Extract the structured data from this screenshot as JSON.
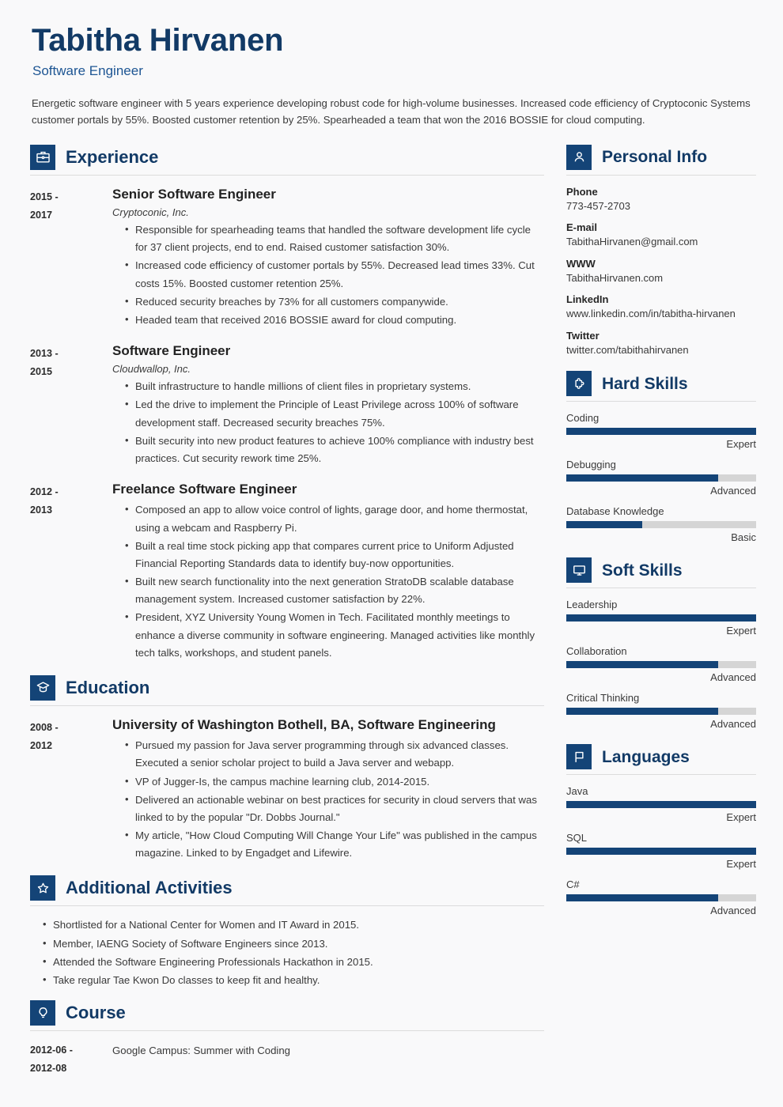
{
  "header": {
    "name": "Tabitha Hirvanen",
    "job_title": "Software Engineer",
    "summary": "Energetic software engineer with 5 years experience developing robust code for high-volume businesses. Increased code efficiency of Cryptoconic Systems customer portals by 55%. Boosted customer retention by 25%. Spearheaded a team that won the 2016 BOSSIE for cloud computing."
  },
  "theme": {
    "navy": "#144477",
    "heading_navy": "#123a66",
    "subtitle_blue": "#1d5593",
    "bar_track": "#d5d5d5",
    "page_bg": "#f9f9fa",
    "rule": "#dcdcdc"
  },
  "sections": {
    "experience": {
      "title": "Experience",
      "icon": "briefcase-icon",
      "entries": [
        {
          "dates_from": "2015 -",
          "dates_to": "2017",
          "title": "Senior Software Engineer",
          "org": "Cryptoconic, Inc.",
          "bullets": [
            "Responsible for spearheading teams that handled the software development life cycle for 37 client projects, end to end. Raised customer satisfaction 30%.",
            "Increased code efficiency of customer portals by 55%. Decreased lead times 33%. Cut costs 15%. Boosted customer retention 25%.",
            "Reduced security breaches by 73% for all customers companywide.",
            "Headed team that received 2016 BOSSIE award for cloud computing."
          ]
        },
        {
          "dates_from": "2013 -",
          "dates_to": "2015",
          "title": "Software Engineer",
          "org": "Cloudwallop, Inc.",
          "bullets": [
            "Built infrastructure to handle millions of client files in proprietary systems.",
            "Led the drive to implement the Principle of Least Privilege across 100% of software development staff. Decreased security breaches 75%.",
            "Built security into new product features to achieve 100% compliance with industry best practices. Cut security rework time 25%."
          ]
        },
        {
          "dates_from": "2012 -",
          "dates_to": "2013",
          "title": "Freelance Software Engineer",
          "org": "",
          "bullets": [
            "Composed an app to allow voice control of lights, garage door, and home thermostat, using a webcam and Raspberry Pi.",
            "Built a real time stock picking app that compares current price to Uniform Adjusted Financial Reporting Standards data to identify buy-now opportunities.",
            "Built new search functionality into the next generation StratoDB scalable database management system. Increased customer satisfaction by 22%.",
            "President, XYZ University Young Women in Tech. Facilitated monthly meetings to enhance a diverse community in software engineering. Managed activities like monthly tech talks, workshops, and student panels."
          ]
        }
      ]
    },
    "education": {
      "title": "Education",
      "icon": "graduation-cap-icon",
      "entries": [
        {
          "dates_from": "2008 -",
          "dates_to": "2012",
          "title": "University of Washington Bothell, BA, Software Engineering",
          "bullets": [
            "Pursued my passion for Java server programming through six advanced classes. Executed a senior scholar project to build a Java server and webapp.",
            "VP of Jugger-Is, the campus machine learning club, 2014-2015.",
            "Delivered an actionable webinar on best practices for security in cloud servers that was linked to by the popular \"Dr. Dobbs Journal.\"",
            "My article, \"How Cloud Computing Will Change Your Life\" was published in the campus magazine. Linked to by Engadget and Lifewire."
          ]
        }
      ]
    },
    "additional_activities": {
      "title": "Additional Activities",
      "icon": "star-icon",
      "bullets": [
        "Shortlisted for a National Center for Women and IT Award in 2015.",
        "Member, IAENG Society of Software Engineers since 2013.",
        "Attended the Software Engineering Professionals Hackathon in 2015.",
        "Take regular Tae Kwon Do classes to keep fit and healthy."
      ]
    },
    "course": {
      "title": "Course",
      "icon": "lightbulb-icon",
      "entries": [
        {
          "dates_from": "2012-06 -",
          "dates_to": "2012-08",
          "text": "Google Campus: Summer with Coding"
        }
      ]
    }
  },
  "sidebar": {
    "personal_info": {
      "title": "Personal Info",
      "icon": "person-icon",
      "items": [
        {
          "label": "Phone",
          "value": "773-457-2703"
        },
        {
          "label": "E-mail",
          "value": "TabithaHirvanen@gmail.com"
        },
        {
          "label": "WWW",
          "value": "TabithaHirvanen.com"
        },
        {
          "label": "LinkedIn",
          "value": "www.linkedin.com/in/tabitha-hirvanen"
        },
        {
          "label": "Twitter",
          "value": "twitter.com/tabithahirvanen"
        }
      ]
    },
    "hard_skills": {
      "title": "Hard Skills",
      "icon": "puzzle-piece-icon",
      "skills": [
        {
          "name": "Coding",
          "level": "Expert",
          "percent": 100
        },
        {
          "name": "Debugging",
          "level": "Advanced",
          "percent": 80
        },
        {
          "name": "Database Knowledge",
          "level": "Basic",
          "percent": 40
        }
      ]
    },
    "soft_skills": {
      "title": "Soft Skills",
      "icon": "monitor-icon",
      "skills": [
        {
          "name": "Leadership",
          "level": "Expert",
          "percent": 100
        },
        {
          "name": "Collaboration",
          "level": "Advanced",
          "percent": 80
        },
        {
          "name": "Critical Thinking",
          "level": "Advanced",
          "percent": 80
        }
      ]
    },
    "languages": {
      "title": "Languages",
      "icon": "flag-icon",
      "skills": [
        {
          "name": "Java",
          "level": "Expert",
          "percent": 100
        },
        {
          "name": "SQL",
          "level": "Expert",
          "percent": 100
        },
        {
          "name": "C#",
          "level": "Advanced",
          "percent": 80
        }
      ]
    }
  }
}
